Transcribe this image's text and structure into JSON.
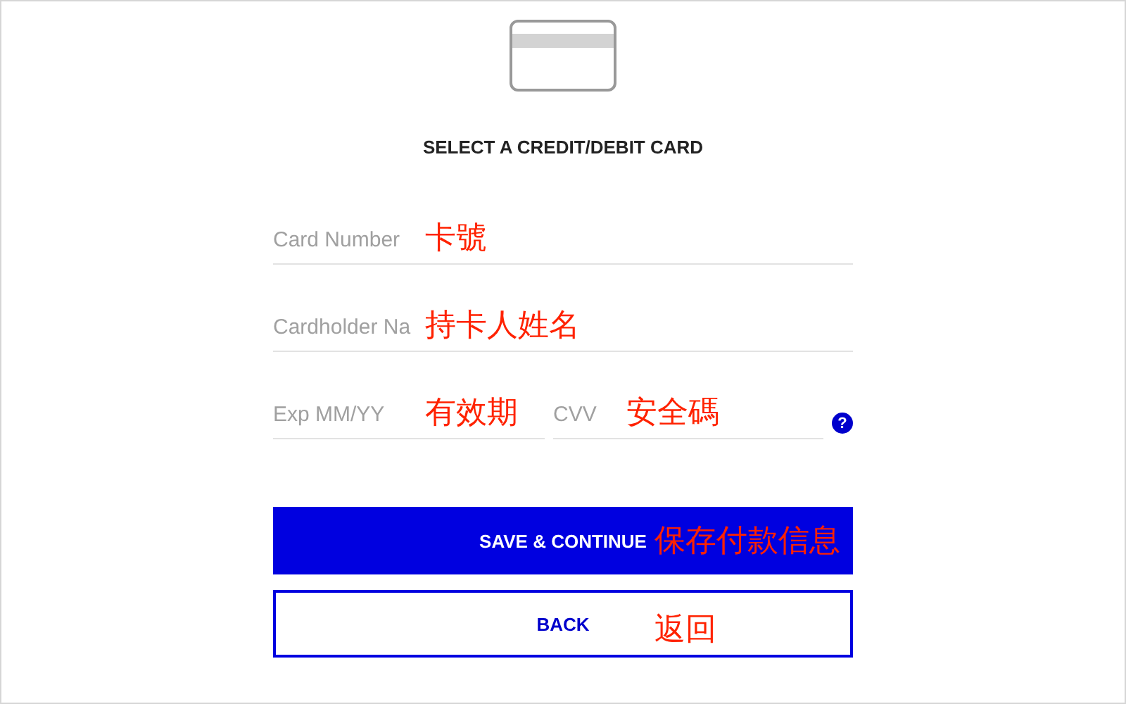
{
  "title": "SELECT A CREDIT/DEBIT CARD",
  "fields": [
    {
      "kind": "full",
      "placeholder": "Card Number",
      "annotation": "卡號"
    },
    {
      "kind": "full",
      "placeholder": "Cardholder Na",
      "annotation": "持卡人姓名"
    }
  ],
  "expiry_row": [
    {
      "placeholder": "Exp MM/YY",
      "annotation": "有效期"
    },
    {
      "placeholder": "CVV",
      "annotation": "安全碼"
    }
  ],
  "help_glyph": "?",
  "buttons": [
    {
      "kind": "primary",
      "label": "SAVE & CONTINUE",
      "annotation": "保存付款信息"
    },
    {
      "kind": "secondary",
      "label": "BACK",
      "annotation": "返回"
    }
  ]
}
